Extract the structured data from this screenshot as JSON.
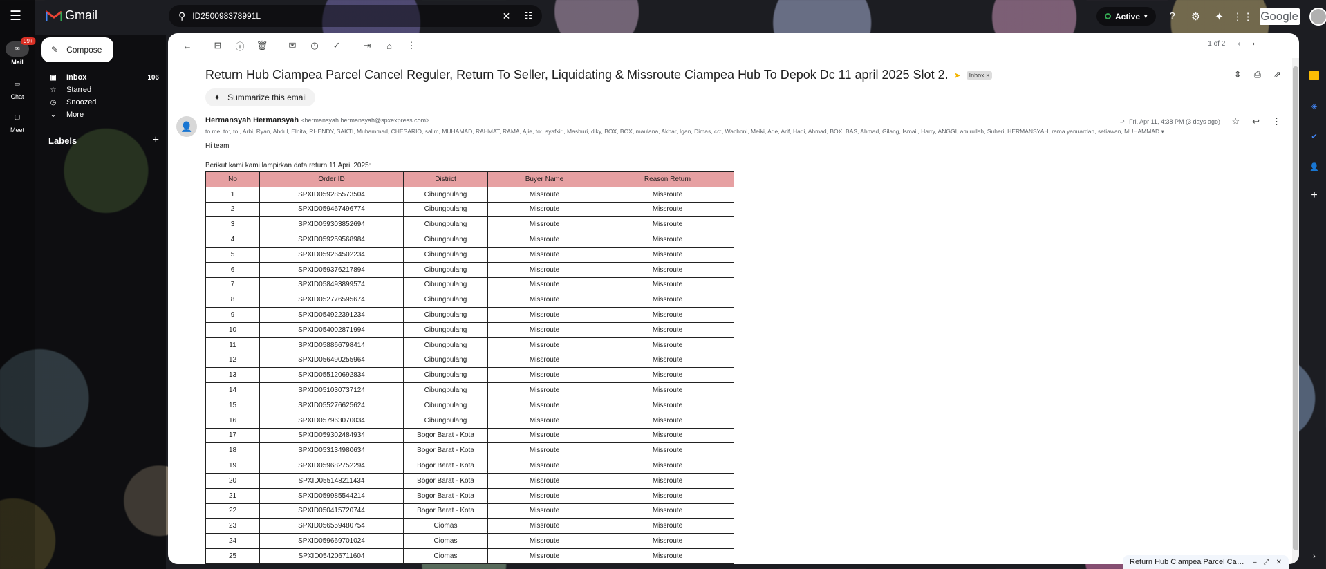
{
  "app": {
    "name": "Gmail"
  },
  "rail": {
    "items": [
      {
        "label": "Mail",
        "badge": "99+"
      },
      {
        "label": "Chat"
      },
      {
        "label": "Meet"
      }
    ]
  },
  "compose": {
    "label": "Compose"
  },
  "nav": {
    "items": [
      {
        "label": "Inbox",
        "count": "106"
      },
      {
        "label": "Starred"
      },
      {
        "label": "Snoozed"
      },
      {
        "label": "More"
      }
    ]
  },
  "labels": {
    "heading": "Labels"
  },
  "search": {
    "query": "ID250098378991L"
  },
  "status": {
    "label": "Active"
  },
  "brand": {
    "google": "Google"
  },
  "pager": {
    "text": "1 of 2"
  },
  "email": {
    "subject": "Return Hub Ciampea Parcel Cancel Reguler, Return To Seller, Liquidating & Missroute Ciampea Hub To Depok Dc 11 april 2025 Slot 2.",
    "inbox_tag": "Inbox ×",
    "summarize": "Summarize this email",
    "sender_name": "Hermansyah Hermansyah",
    "sender_email": "<hermansyah.hermansyah@spxexpress.com>",
    "recipients": "to me, to:, to:, Arbi, Ryan, Abdul, Elnita, RHENDY, SAKTI, Muhammad, CHESARIO, salim, MUHAMAD, RAHMAT, RAMA, Ajie, to:, syafkiri, Mashuri, diky, BOX, BOX, maulana, Akbar, Igan, Dimas, cc:, Wachoni, Meiki, Ade, Arif, Hadi, Ahmad, BOX, BAS, Ahmad, Gilang, Ismail, Harry, ANGGI, amirullah, Suheri, HERMANSYAH, rama.yanuardan, setiawan, MUHAMMAD",
    "date": "Fri, Apr 11, 4:38 PM (3 days ago)",
    "greeting": "Hi team",
    "intro": "Berikut kami kami lampirkan data return 11 April 2025:"
  },
  "table": {
    "headers": [
      "No",
      "Order ID",
      "District",
      "Buyer Name",
      "Reason Return"
    ],
    "rows": [
      [
        "1",
        "SPXID059285573504",
        "Cibungbulang",
        "Missroute",
        "Missroute"
      ],
      [
        "2",
        "SPXID059467496774",
        "Cibungbulang",
        "Missroute",
        "Missroute"
      ],
      [
        "3",
        "SPXID059303852694",
        "Cibungbulang",
        "Missroute",
        "Missroute"
      ],
      [
        "4",
        "SPXID059259568984",
        "Cibungbulang",
        "Missroute",
        "Missroute"
      ],
      [
        "5",
        "SPXID059264502234",
        "Cibungbulang",
        "Missroute",
        "Missroute"
      ],
      [
        "6",
        "SPXID059376217894",
        "Cibungbulang",
        "Missroute",
        "Missroute"
      ],
      [
        "7",
        "SPXID058493899574",
        "Cibungbulang",
        "Missroute",
        "Missroute"
      ],
      [
        "8",
        "SPXID052776595674",
        "Cibungbulang",
        "Missroute",
        "Missroute"
      ],
      [
        "9",
        "SPXID054922391234",
        "Cibungbulang",
        "Missroute",
        "Missroute"
      ],
      [
        "10",
        "SPXID054002871994",
        "Cibungbulang",
        "Missroute",
        "Missroute"
      ],
      [
        "11",
        "SPXID058866798414",
        "Cibungbulang",
        "Missroute",
        "Missroute"
      ],
      [
        "12",
        "SPXID056490255964",
        "Cibungbulang",
        "Missroute",
        "Missroute"
      ],
      [
        "13",
        "SPXID055120692834",
        "Cibungbulang",
        "Missroute",
        "Missroute"
      ],
      [
        "14",
        "SPXID051030737124",
        "Cibungbulang",
        "Missroute",
        "Missroute"
      ],
      [
        "15",
        "SPXID055276625624",
        "Cibungbulang",
        "Missroute",
        "Missroute"
      ],
      [
        "16",
        "SPXID057963070034",
        "Cibungbulang",
        "Missroute",
        "Missroute"
      ],
      [
        "17",
        "SPXID059302484934",
        "Bogor Barat - Kota",
        "Missroute",
        "Missroute"
      ],
      [
        "18",
        "SPXID053134980634",
        "Bogor Barat - Kota",
        "Missroute",
        "Missroute"
      ],
      [
        "19",
        "SPXID059682752294",
        "Bogor Barat - Kota",
        "Missroute",
        "Missroute"
      ],
      [
        "20",
        "SPXID055148211434",
        "Bogor Barat - Kota",
        "Missroute",
        "Missroute"
      ],
      [
        "21",
        "SPXID059985544214",
        "Bogor Barat - Kota",
        "Missroute",
        "Missroute"
      ],
      [
        "22",
        "SPXID050415720744",
        "Bogor Barat - Kota",
        "Missroute",
        "Missroute"
      ],
      [
        "23",
        "SPXID056559480754",
        "Ciomas",
        "Missroute",
        "Missroute"
      ],
      [
        "24",
        "SPXID059669701024",
        "Ciomas",
        "Missroute",
        "Missroute"
      ],
      [
        "25",
        "SPXID054206711604",
        "Ciomas",
        "Missroute",
        "Missroute"
      ]
    ]
  },
  "minimized": {
    "title": "Return Hub Ciampea Parcel Canc..."
  },
  "colors": {
    "table_header": "#e6a0a2",
    "active_dot": "#34a853",
    "badge": "#d93025"
  }
}
